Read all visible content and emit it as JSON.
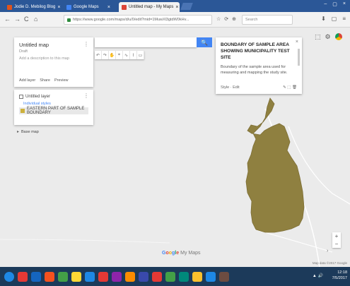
{
  "browser": {
    "tabs": [
      {
        "title": "Jodie D. Mebilog Blog",
        "color": "#e0541c"
      },
      {
        "title": "Google Maps",
        "color": "#4285f4"
      },
      {
        "title": "Untitled map - My Maps",
        "color": "#db4437"
      }
    ],
    "tab_close_glyph": "×",
    "address": "https://www.google.com/maps/d/u/0/edit?mid=1MuwXl3gtdW0kHv...",
    "search_placeholder": "Search",
    "window_controls": [
      "–",
      "▢",
      "×"
    ]
  },
  "nav": {
    "back": "←",
    "forward": "→",
    "reload": "C",
    "home": "⌂"
  },
  "toolbar_icons": [
    "☆",
    "⟳",
    "⊕"
  ],
  "toolbar_right": [
    "⬇",
    "▢",
    "≡"
  ],
  "map_panel": {
    "title": "Untitled map",
    "subtitle": "Draft",
    "description": "Add a description to this map",
    "actions": [
      "Add layer",
      "Share",
      "Preview"
    ],
    "kebab": "⋮"
  },
  "layer_panel": {
    "layer_name": "Untitled layer",
    "style_link": "Individual styles",
    "feature": "EASTERN PART OF SAMPLE BOUNDARY",
    "kebab": "⋮"
  },
  "base_map": {
    "arrow": "▸",
    "label": "Base map"
  },
  "search_button_glyph": "🔍",
  "drawing_tools": [
    "↶",
    "↷",
    "✋",
    "⌖",
    "∿",
    "⌇",
    "▭"
  ],
  "info_card": {
    "title": "BOUNDARY OF SAMPLE AREA SHOWING MUNICIPALITY TEST SITE",
    "description": "Boundary of the sample area used for measuring and mapping the study site.",
    "footer_left": "Style  ·  Edit",
    "footer_icons": "✎  ⬚  🗑",
    "close": "×"
  },
  "top_right_icons": [
    "⬚",
    "⚙"
  ],
  "map_logo": {
    "g": "G",
    "o1": "o",
    "o2": "o",
    "g2": "g",
    "l": "l",
    "e": "e",
    "suffix": "My Maps"
  },
  "zoom": {
    "in": "+",
    "out": "−"
  },
  "map_chevron": "›",
  "attribution": "Map data ©2017 Google",
  "shape_color": "#8f8040",
  "taskbar": {
    "apps": [
      "#1e88e5",
      "#e53935",
      "#1565c0",
      "#f4511e",
      "#43a047",
      "#fdd835",
      "#1e88e5",
      "#e53935",
      "#8e24aa",
      "#fb8c00",
      "#3949ab",
      "#e53935",
      "#43a047",
      "#00897b",
      "#fbc02d",
      "#1e88e5",
      "#6d4c41"
    ],
    "tray_icons": "▲ 🔊",
    "time": "12:18",
    "date": "7/5/2017"
  }
}
